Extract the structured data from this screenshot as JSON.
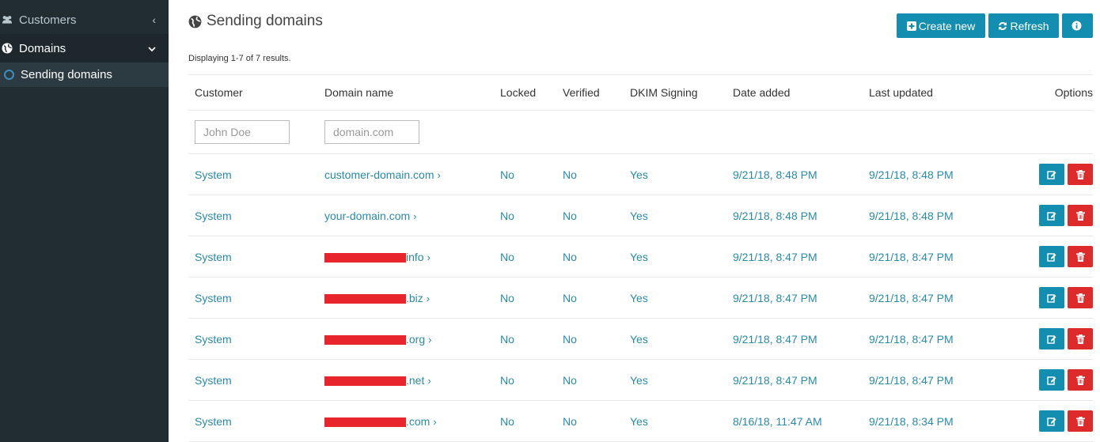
{
  "sidebar": {
    "items": [
      {
        "label": "Customers",
        "icon": "users-icon",
        "chevron": "‹"
      },
      {
        "label": "Domains",
        "icon": "globe-icon",
        "chevron": "⌄"
      },
      {
        "label": "Sending domains",
        "icon": "circle-icon"
      }
    ]
  },
  "header": {
    "title": "Sending domains",
    "create_label": "Create new",
    "refresh_label": "Refresh"
  },
  "summary": "Displaying 1-7 of 7 results.",
  "table": {
    "columns": [
      "Customer",
      "Domain name",
      "Locked",
      "Verified",
      "DKIM Signing",
      "Date added",
      "Last updated",
      "Options"
    ],
    "filters": {
      "customer_placeholder": "John Doe",
      "domain_placeholder": "domain.com"
    },
    "rows": [
      {
        "customer": "System",
        "domain": "customer-domain.com",
        "redacted": false,
        "locked": "No",
        "verified": "No",
        "dkim": "Yes",
        "added": "9/21/18, 8:48 PM",
        "updated": "9/21/18, 8:48 PM"
      },
      {
        "customer": "System",
        "domain": "your-domain.com",
        "redacted": false,
        "locked": "No",
        "verified": "No",
        "dkim": "Yes",
        "added": "9/21/18, 8:48 PM",
        "updated": "9/21/18, 8:48 PM"
      },
      {
        "customer": "System",
        "domain": "info",
        "redacted": true,
        "locked": "No",
        "verified": "No",
        "dkim": "Yes",
        "added": "9/21/18, 8:47 PM",
        "updated": "9/21/18, 8:47 PM"
      },
      {
        "customer": "System",
        "domain": ".biz",
        "redacted": true,
        "locked": "No",
        "verified": "No",
        "dkim": "Yes",
        "added": "9/21/18, 8:47 PM",
        "updated": "9/21/18, 8:47 PM"
      },
      {
        "customer": "System",
        "domain": ".org",
        "redacted": true,
        "locked": "No",
        "verified": "No",
        "dkim": "Yes",
        "added": "9/21/18, 8:47 PM",
        "updated": "9/21/18, 8:47 PM"
      },
      {
        "customer": "System",
        "domain": ".net",
        "redacted": true,
        "locked": "No",
        "verified": "No",
        "dkim": "Yes",
        "added": "9/21/18, 8:47 PM",
        "updated": "9/21/18, 8:47 PM"
      },
      {
        "customer": "System",
        "domain": ".com",
        "redacted": true,
        "locked": "No",
        "verified": "No",
        "dkim": "Yes",
        "added": "8/16/18, 11:47 AM",
        "updated": "9/21/18, 8:34 PM"
      }
    ]
  },
  "colors": {
    "sidebar_bg": "#222d32",
    "accent": "#138eb1",
    "danger": "#dd2b2b",
    "link": "#2a8aaa",
    "redaction": "#e8252d"
  }
}
